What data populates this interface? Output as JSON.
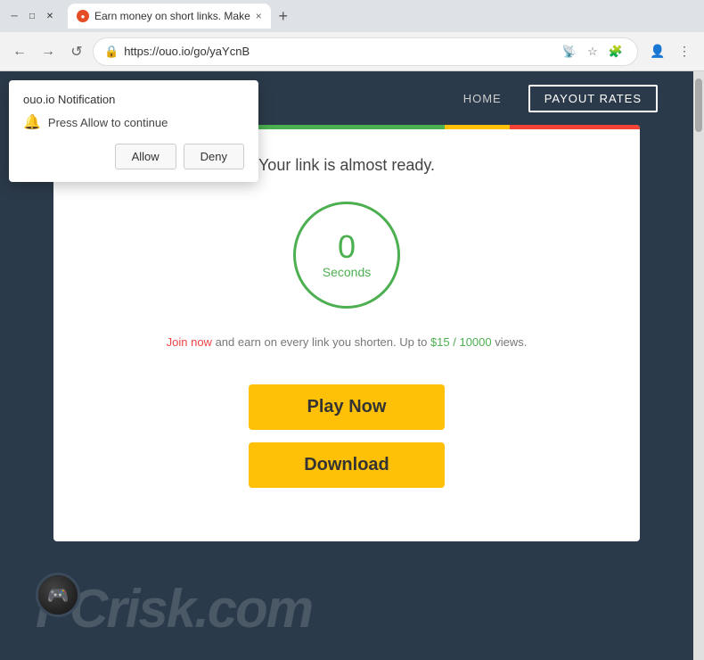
{
  "browser": {
    "tab": {
      "favicon_label": "●",
      "title": "Earn money on short links. Make",
      "close": "×"
    },
    "new_tab_btn": "+",
    "nav": {
      "back": "←",
      "forward": "→",
      "refresh": "↺"
    },
    "url": "https://ouo.io/go/yaYcnB",
    "url_actions": {
      "cast": "📡",
      "star": "☆",
      "puzzle": "🧩"
    },
    "profile": "👤",
    "menu": "⋮"
  },
  "notification": {
    "title": "ouo.io Notification",
    "message": "Press Allow to continue",
    "allow_btn": "Allow",
    "deny_btn": "Deny"
  },
  "site": {
    "nav": {
      "home": "HOME",
      "payout": "PAYOUT RATES"
    },
    "card": {
      "ready_text": "Your link is almost ready.",
      "timer_number": "0",
      "timer_label": "Seconds",
      "join_text_before": "",
      "join_link": "Join now",
      "join_text_middle": " and earn on every link you shorten. Up to ",
      "rate_link": "$15 / 10000",
      "join_text_after": " views.",
      "play_btn": "Play Now",
      "download_btn": "Download"
    }
  },
  "pcrisk": {
    "logo_text": "PCrisk.com"
  }
}
